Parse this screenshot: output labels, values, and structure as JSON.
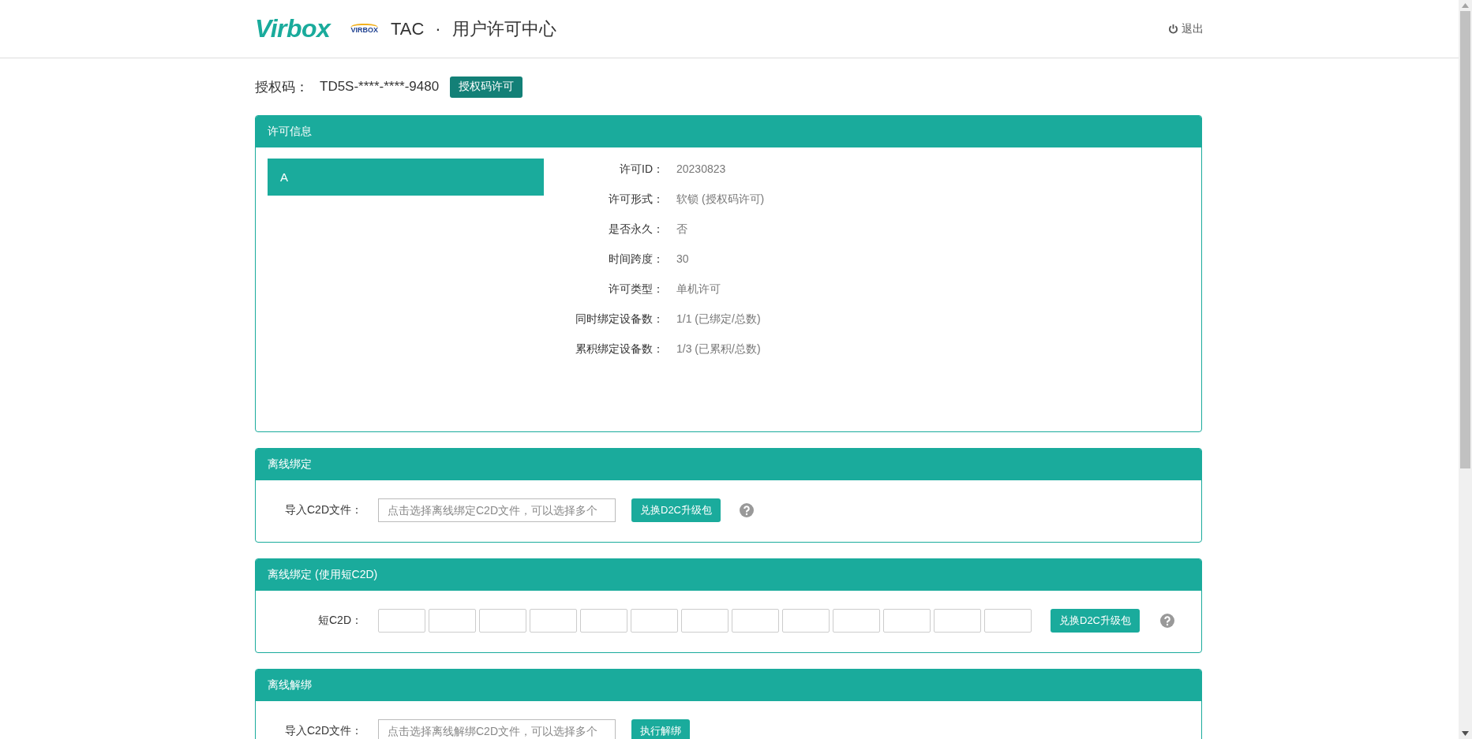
{
  "header": {
    "logo": "Virbox",
    "badge": "VIRBOX",
    "product": "TAC",
    "separator": "·",
    "title": "用户许可中心",
    "logout": "退出"
  },
  "auth": {
    "label": "授权码：",
    "value": "TD5S-****-****-9480",
    "button": "授权码许可"
  },
  "license_info": {
    "title": "许可信息",
    "licenses": [
      {
        "label": "A",
        "selected": true
      }
    ],
    "fields": [
      {
        "label": "许可ID：",
        "value": "20230823"
      },
      {
        "label": "许可形式：",
        "value": "软锁 (授权码许可)"
      },
      {
        "label": "是否永久：",
        "value": "否"
      },
      {
        "label": "时间跨度：",
        "value": "30"
      },
      {
        "label": "许可类型：",
        "value": "单机许可"
      },
      {
        "label": "同时绑定设备数：",
        "value": "1/1 (已绑定/总数)"
      },
      {
        "label": "累积绑定设备数：",
        "value": "1/3 (已累积/总数)"
      }
    ]
  },
  "sections": [
    {
      "kind": "file",
      "title": "离线绑定",
      "label": "导入C2D文件：",
      "placeholder": "点击选择离线绑定C2D文件，可以选择多个",
      "button": "兑换D2C升级包",
      "help": true
    },
    {
      "kind": "code",
      "title": "离线绑定 (使用短C2D)",
      "label": "短C2D：",
      "button": "兑换D2C升级包",
      "help": true
    },
    {
      "kind": "file",
      "title": "离线解绑",
      "label": "导入C2D文件：",
      "placeholder": "点击选择离线解绑C2D文件，可以选择多个",
      "button": "执行解绑",
      "help": false
    }
  ]
}
